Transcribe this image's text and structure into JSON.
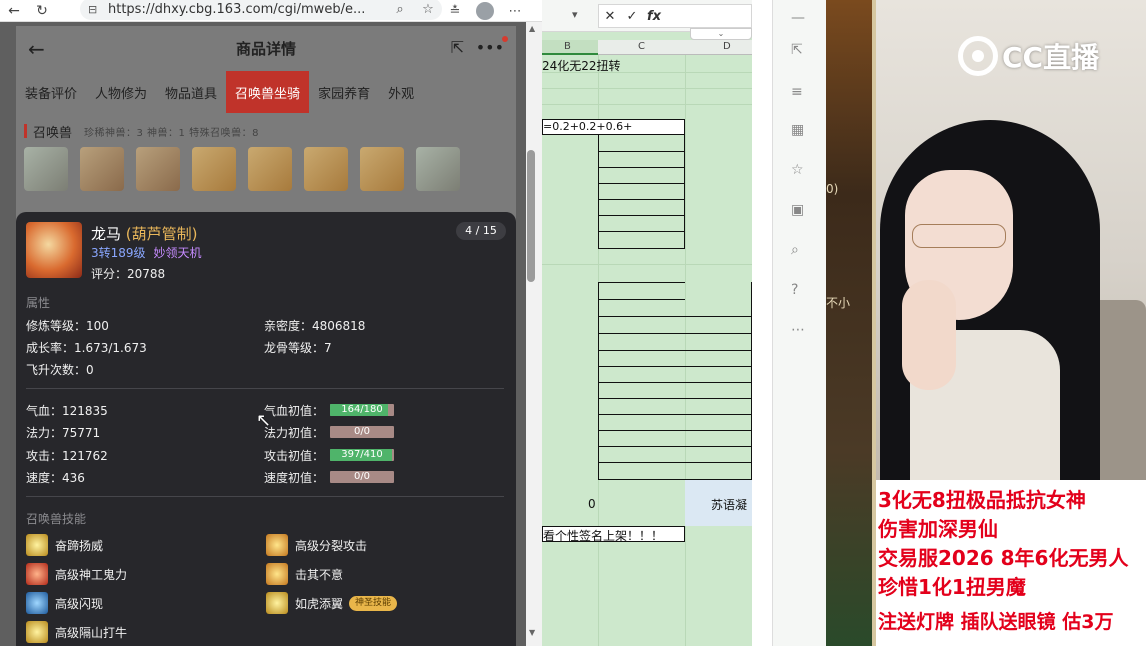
{
  "browser": {
    "url": "https://dhxy.cbg.163.com/cgi/mweb/e...",
    "back_icon": "arrow-left-icon",
    "refresh_icon": "refresh-icon"
  },
  "page": {
    "title": "商品详情",
    "tabs": [
      "装备评价",
      "人物修为",
      "物品道具",
      "召唤兽坐骑",
      "家园养育",
      "外观"
    ],
    "active_tab": 3,
    "summon_section_title": "召唤兽",
    "summon_counts": "珍稀神兽：3    神兽：1    特殊召唤兽：8"
  },
  "pet": {
    "name": "龙马",
    "tag": "(葫芦管制)",
    "level": "3转189级",
    "talent": "妙领天机",
    "score_label": "评分：",
    "score": "20788",
    "page_indicator": "4 / 15",
    "attributes_title": "属性",
    "attributes": {
      "cultivation": "修炼等级：100",
      "intimacy": "亲密度：4806818",
      "growth": "成长率：1.673/1.673",
      "dragon_bone": "龙骨等级：7",
      "ascension": "飞升次数：0"
    },
    "stats": {
      "hp": "气血：121835",
      "mp": "法力：75771",
      "attack": "攻击：121762",
      "speed": "速度：436",
      "hp_init_label": "气血初值：",
      "mp_init_label": "法力初值：",
      "attack_init_label": "攻击初值：",
      "speed_init_label": "速度初值："
    },
    "init_bars": [
      {
        "text": "164/180",
        "fraction": 0.911
      },
      {
        "text": "0/0",
        "fraction": 0
      },
      {
        "text": "397/410",
        "fraction": 0.968
      },
      {
        "text": "0/0",
        "fraction": 0
      }
    ],
    "skills_title": "召唤兽技能",
    "skills": [
      "奋蹄扬威",
      "高级分裂攻击",
      "高级神工鬼力",
      "击其不意",
      "高级闪现",
      "如虎添翼",
      "高级隔山打牛"
    ],
    "skill_badge": "神圣技能"
  },
  "sheet": {
    "col_b": "B",
    "col_c": "C",
    "col_d": "D",
    "top_text": "24化无22扭转",
    "formula_text": "=0.2+0.2+0.6+",
    "zero_text": "0",
    "right_text": "苏语凝",
    "note_text": "看个性签名上架！！！"
  },
  "game_texts": [
    "0)",
    "不小"
  ],
  "stream": {
    "logo_text": "CC直播",
    "ticker": [
      "3化无8扭极品抵抗女神",
      "伤害加深男仙",
      "交易服2026 8年6化无男人",
      "珍惜1化1扭男魔",
      "注送灯牌 插队送眼镜  估3万"
    ]
  }
}
